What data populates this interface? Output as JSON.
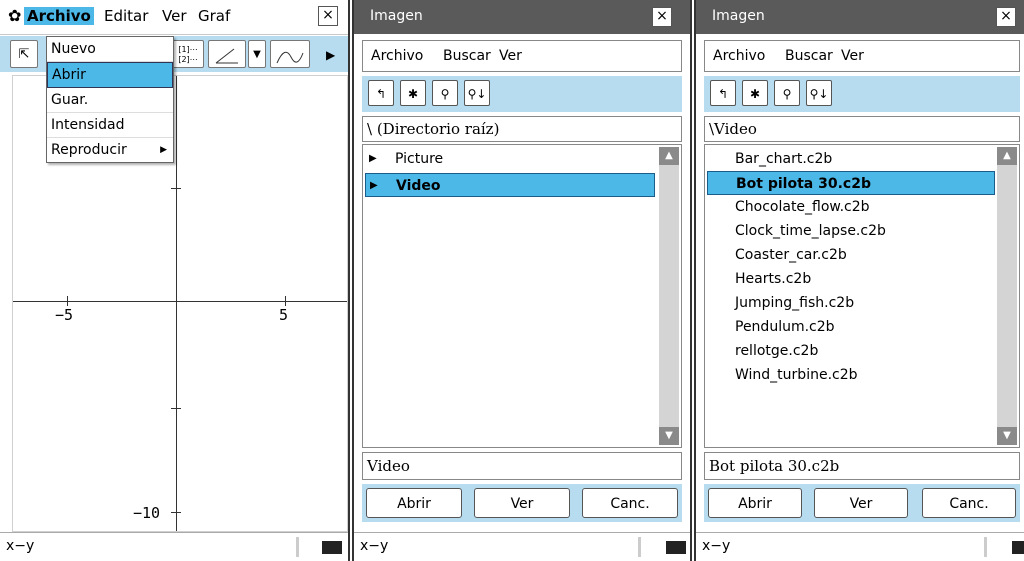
{
  "panel1": {
    "menu": [
      "Archivo",
      "Editar",
      "Ver",
      "Graf"
    ],
    "dropdown": [
      "Nuevo",
      "Abrir",
      "Guar.",
      "Intensidad",
      "Reproducir"
    ],
    "toolbar_icons": [
      "select-arrow-icon",
      "table-icon",
      "graph-icon",
      "dropdown-arrow-icon",
      "curve-icon",
      "play-icon"
    ],
    "toolbar_text": "[1]\n[2]",
    "x_labels": [
      "−5",
      "5"
    ],
    "y_label": "−10",
    "status": "x−y",
    "close": "×"
  },
  "panel2": {
    "title": "Imagen",
    "menu": [
      "Archivo",
      "Buscar",
      "Ver"
    ],
    "path": "\\  (Directorio raíz)",
    "items": [
      "Picture",
      "Video"
    ],
    "name_field": "Video",
    "buttons": [
      "Abrir",
      "Ver",
      "Canc."
    ],
    "status": "x−y",
    "close": "×"
  },
  "panel3": {
    "title": "Imagen",
    "menu": [
      "Archivo",
      "Buscar",
      "Ver"
    ],
    "path": "\\Video",
    "files": [
      "Bar_chart.c2b",
      "Bot pilota 30.c2b",
      "Chocolate_flow.c2b",
      "Clock_time_lapse.c2b",
      "Coaster_car.c2b",
      "Hearts.c2b",
      "Jumping_fish.c2b",
      "Pendulum.c2b",
      "rellotge.c2b",
      "Wind_turbine.c2b"
    ],
    "name_field": "Bot pilota 30.c2b",
    "buttons": [
      "Abrir",
      "Ver",
      "Canc."
    ],
    "status": "x−y",
    "close": "×"
  },
  "colors": {
    "highlight": "#4cb8e8",
    "toolbar": "#b8dcef",
    "titlebar": "#5a5a5a"
  }
}
